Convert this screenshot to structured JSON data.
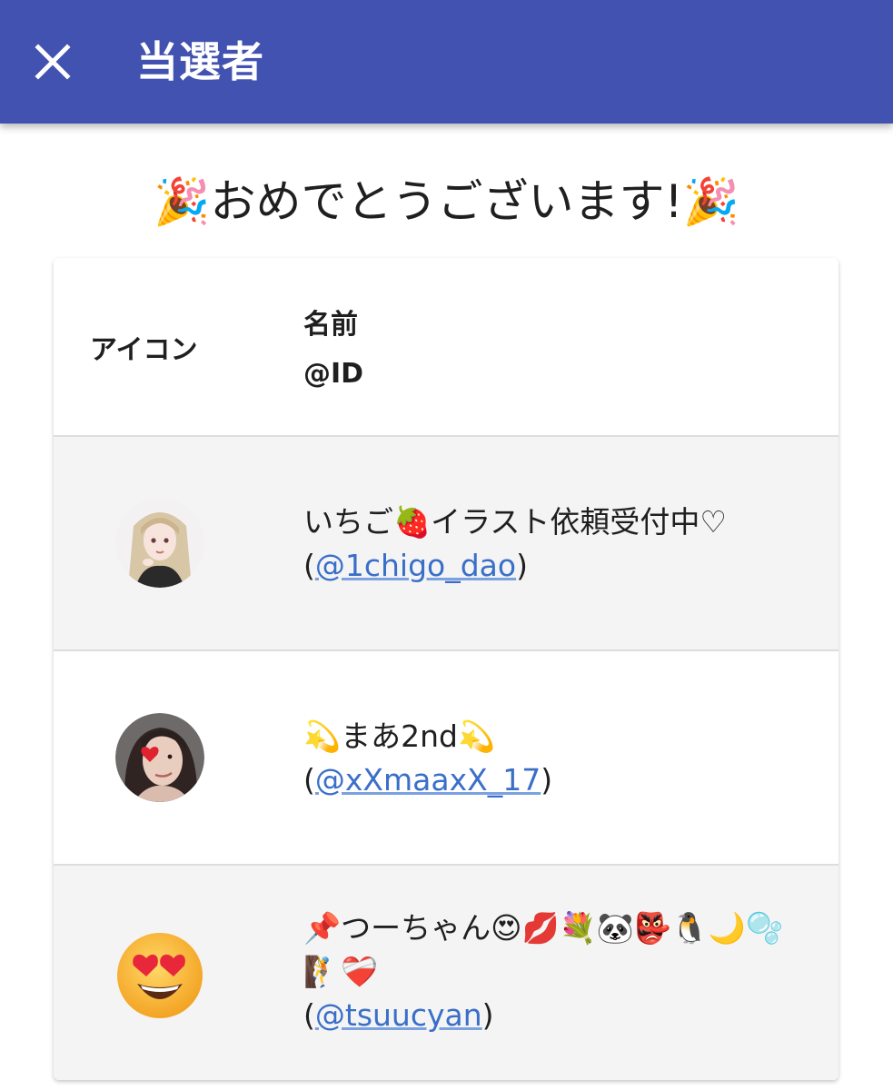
{
  "appbar": {
    "title": "当選者",
    "close_icon": "close-icon",
    "color": "#4152b0"
  },
  "congrats": {
    "text": "🎉おめでとうございます!🎉"
  },
  "table": {
    "headers": {
      "icon": "アイコン",
      "name": "名前",
      "id": "@ID"
    },
    "rows": [
      {
        "name": "いちご🍓イラスト依頼受付中♡",
        "open_paren": "(",
        "id": "@1chigo_dao",
        "close_paren": ")",
        "avatar": "avatar-illustration-girl"
      },
      {
        "name": "💫まあ2nd💫",
        "open_paren": "(",
        "id": "@xXmaaxX_17",
        "close_paren": ")",
        "avatar": "avatar-photo-girl-heart"
      },
      {
        "name": "📌つーちゃん😍💋💐🐼👺🐧🌙🫧🧗❤️‍🩹",
        "open_paren": "(",
        "id": "@tsuucyan",
        "close_paren": ")",
        "avatar": "avatar-heart-eyes-emoji"
      }
    ]
  },
  "colors": {
    "link": "#3a6fc9",
    "row_alt": "#f4f4f4"
  }
}
